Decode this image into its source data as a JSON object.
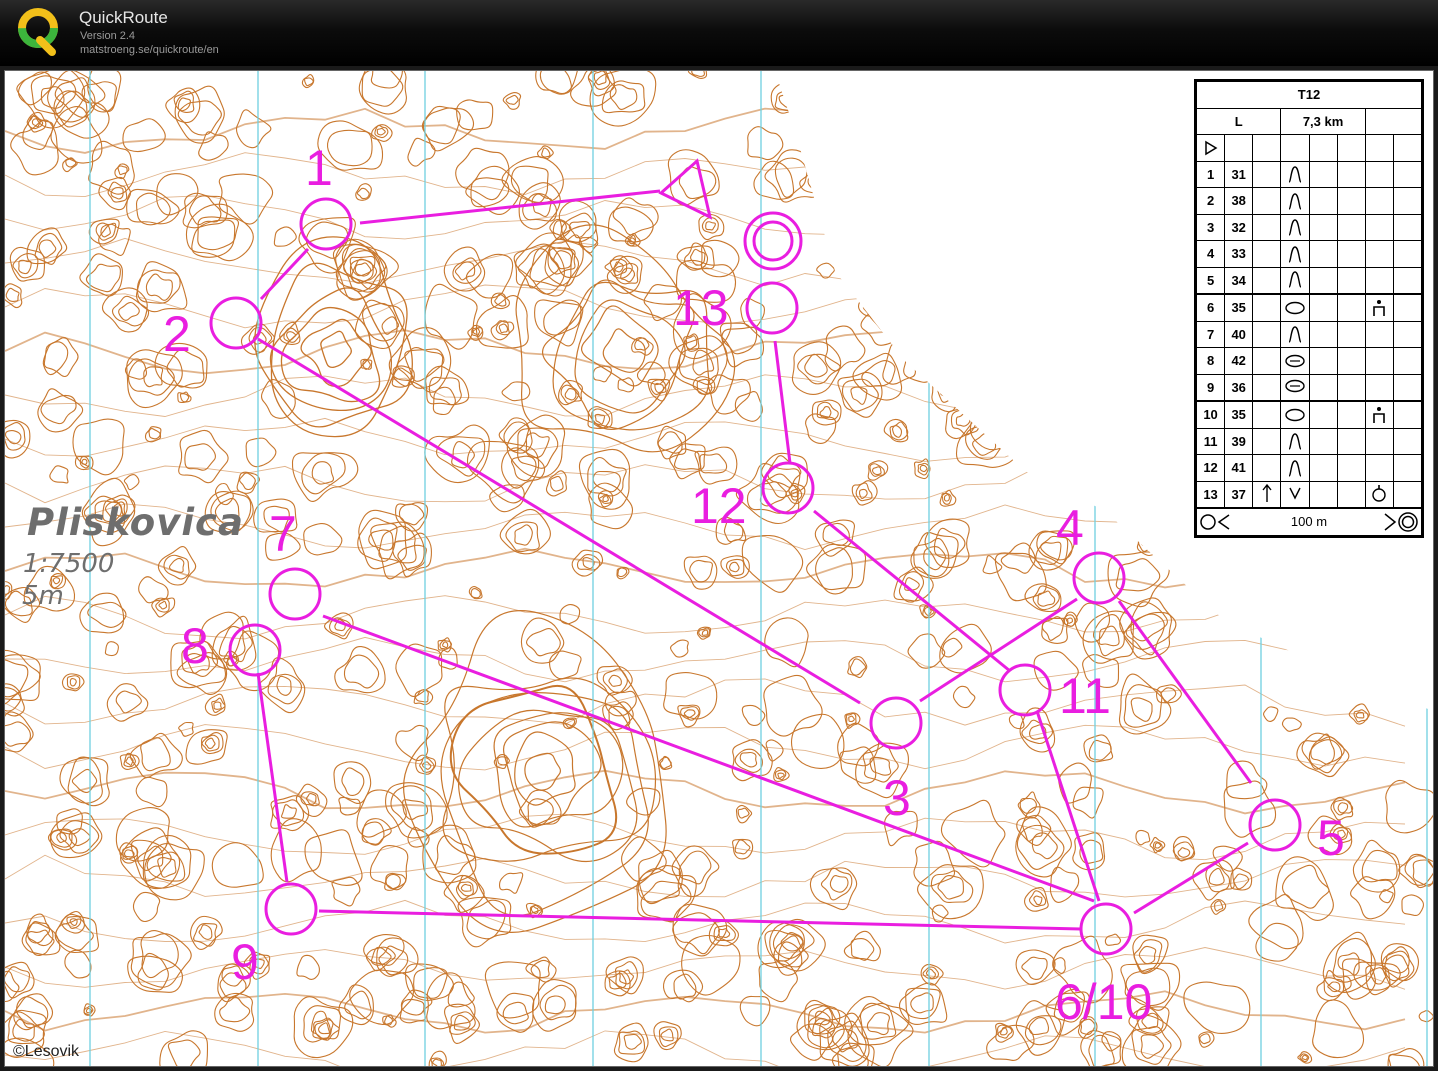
{
  "app": {
    "name": "QuickRoute",
    "version": "Version 2.4",
    "url": "matstroeng.se/quickroute/en",
    "logo_icon": "quickroute-q-logo-icon"
  },
  "map": {
    "name": "Pliskovica",
    "scale": "1:7500",
    "contour_interval": "5m",
    "copyright": "©Lesovik",
    "course_color": "#e91ee0",
    "contour_color": "#c8772d",
    "control_labels": {
      "c1": "1",
      "c2": "2",
      "c3": "3",
      "c4": "4",
      "c5": "5",
      "c6_10": "6/10",
      "c7": "7",
      "c8": "8",
      "c9": "9",
      "c11": "11",
      "c12": "12",
      "c13": "13"
    }
  },
  "description": {
    "title": "T12",
    "class": "L",
    "length": "7,3 km",
    "start_icon": "start-triangle-icon",
    "controls": [
      {
        "num": "1",
        "code": "31",
        "feature": "knoll-icon",
        "extra": ""
      },
      {
        "num": "2",
        "code": "38",
        "feature": "knoll-icon",
        "extra": ""
      },
      {
        "num": "3",
        "code": "32",
        "feature": "knoll-icon",
        "extra": ""
      },
      {
        "num": "4",
        "code": "33",
        "feature": "knoll-icon",
        "extra": ""
      },
      {
        "num": "5",
        "code": "34",
        "feature": "knoll-icon",
        "extra": ""
      },
      {
        "num": "6",
        "code": "35",
        "feature": "depression-icon",
        "extra": "manned-control-icon"
      },
      {
        "num": "7",
        "code": "40",
        "feature": "knoll-icon",
        "extra": ""
      },
      {
        "num": "8",
        "code": "42",
        "feature": "hole-icon",
        "extra": ""
      },
      {
        "num": "9",
        "code": "36",
        "feature": "hole-icon",
        "extra": ""
      },
      {
        "num": "10",
        "code": "35",
        "feature": "depression-icon",
        "extra": "manned-control-icon"
      },
      {
        "num": "11",
        "code": "39",
        "feature": "knoll-icon",
        "extra": ""
      },
      {
        "num": "12",
        "code": "41",
        "feature": "knoll-icon",
        "extra": ""
      },
      {
        "num": "13",
        "code": "37",
        "feature": "north-arrow-icon",
        "extra": "water-control-icon"
      }
    ],
    "finish": {
      "distance": "100 m",
      "icon": "finish-route-icon"
    }
  }
}
